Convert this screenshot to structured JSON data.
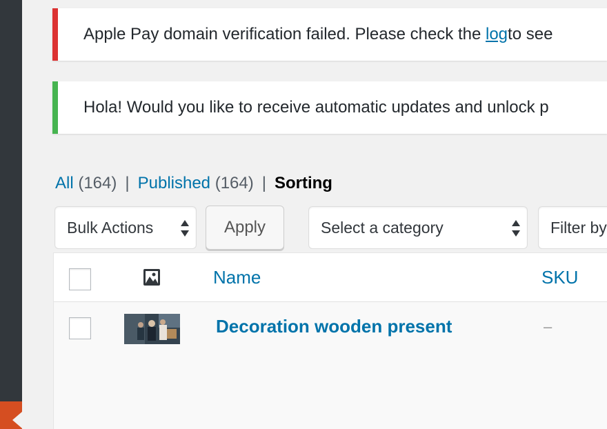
{
  "notices": {
    "error": {
      "text_before": "Apple Pay domain verification failed. Please check the ",
      "link": "log",
      "text_after": " to see"
    },
    "info": {
      "text": "Hola! Would you like to receive automatic updates and unlock p"
    }
  },
  "views": {
    "all_label": "All",
    "all_count": "(164)",
    "separator": "|",
    "published_label": "Published",
    "published_count": "(164)",
    "sorting_label": "Sorting"
  },
  "controls": {
    "bulk_actions": "Bulk Actions",
    "apply": "Apply",
    "category": "Select a category",
    "filter": "Filter by"
  },
  "table": {
    "columns": {
      "thumb_icon": "image-icon",
      "name": "Name",
      "sku": "SKU"
    },
    "rows": [
      {
        "name": "Decoration wooden present",
        "sku": "–"
      }
    ]
  },
  "colors": {
    "link": "#0073aa",
    "error_border": "#dc3232",
    "info_border": "#46b450",
    "admin_bar": "#32373c",
    "accent": "#d54e21"
  }
}
